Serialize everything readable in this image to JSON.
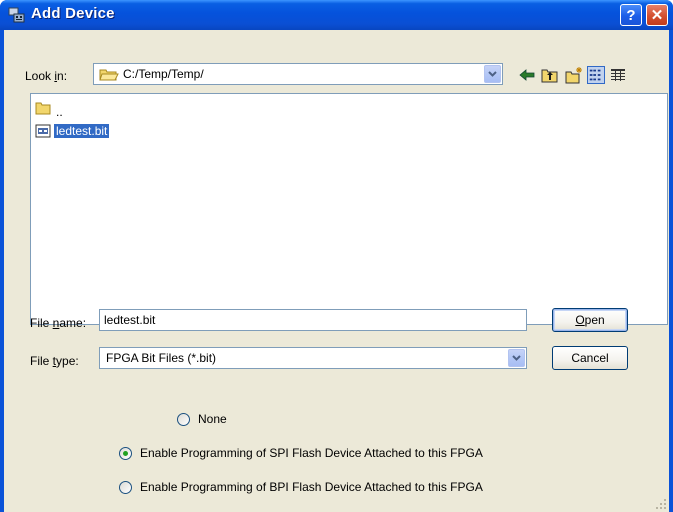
{
  "window": {
    "title": "Add Device",
    "help_label": "?",
    "close_label": "✕"
  },
  "look_in": {
    "label_prefix": "Look ",
    "label_underlined": "i",
    "label_suffix": "n:",
    "path": "C:/Temp/Temp/"
  },
  "toolbar": {
    "icons": [
      "back-icon",
      "up-folder-icon",
      "new-folder-icon",
      "list-view-icon",
      "detail-view-icon"
    ]
  },
  "file_list": {
    "items": [
      {
        "name": "..",
        "icon": "folder-icon",
        "selected": false
      },
      {
        "name": "ledtest.bit",
        "icon": "bit-file-icon",
        "selected": true
      }
    ]
  },
  "file_name": {
    "label_prefix": "File ",
    "label_underlined": "n",
    "label_suffix": "ame:",
    "value": "ledtest.bit"
  },
  "file_type": {
    "label_prefix": "File ",
    "label_underlined": "t",
    "label_suffix": "ype:",
    "value": "FPGA Bit Files (*.bit)"
  },
  "buttons": {
    "open_underlined": "O",
    "open_rest": "pen",
    "cancel": "Cancel"
  },
  "options": {
    "none": "None",
    "spi": "Enable Programming of SPI Flash Device Attached to this FPGA",
    "bpi": "Enable Programming of BPI Flash Device Attached to this FPGA",
    "selected": "spi"
  },
  "colors": {
    "titlebar": "#0552dc",
    "dialog_bg": "#ece9d8",
    "selection": "#316ac5",
    "radio_dot": "#21a121"
  }
}
